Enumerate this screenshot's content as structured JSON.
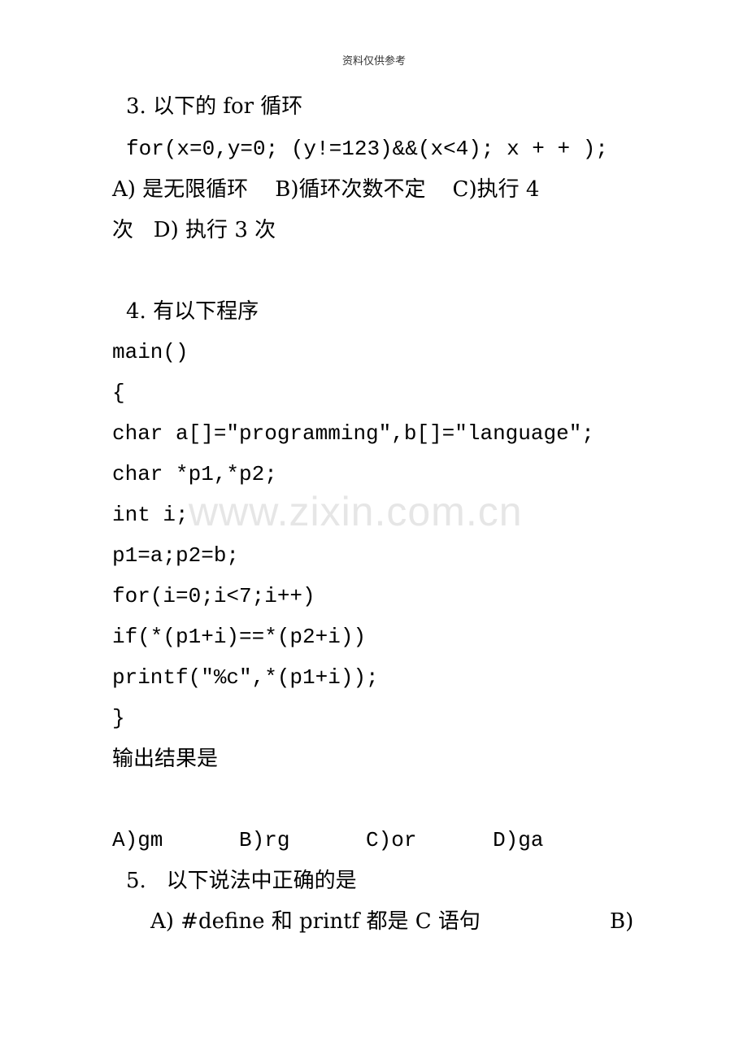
{
  "header": {
    "text": "资料仅供参考"
  },
  "watermark": {
    "text": "www.zixin.com.cn"
  },
  "q3": {
    "title": "3. 以下的 for 循环",
    "code": "for(x=0,y=0; (y!=123)&&(x<4); x + + );",
    "options_line1": "A) 是无限循环    B)循环次数不定    C)执行 4",
    "options_line2": "次   D) 执行 3 次"
  },
  "q4": {
    "title": "4. 有以下程序",
    "code_lines": [
      "main()",
      "{",
      "char a[]=\"programming\",b[]=\"language\";",
      "char *p1,*p2;",
      "int i;",
      "p1=a;p2=b;",
      "for(i=0;i<7;i++)",
      "if(*(p1+i)==*(p2+i))",
      "printf(\"%c\",*(p1+i));",
      "}"
    ],
    "prompt": "输出结果是",
    "options": "A)gm      B)rg      C)or      D)ga"
  },
  "q5": {
    "title": "5.   以下说法中正确的是",
    "option_a": "A) #define 和 printf 都是 C 语句",
    "option_b": "B)"
  }
}
